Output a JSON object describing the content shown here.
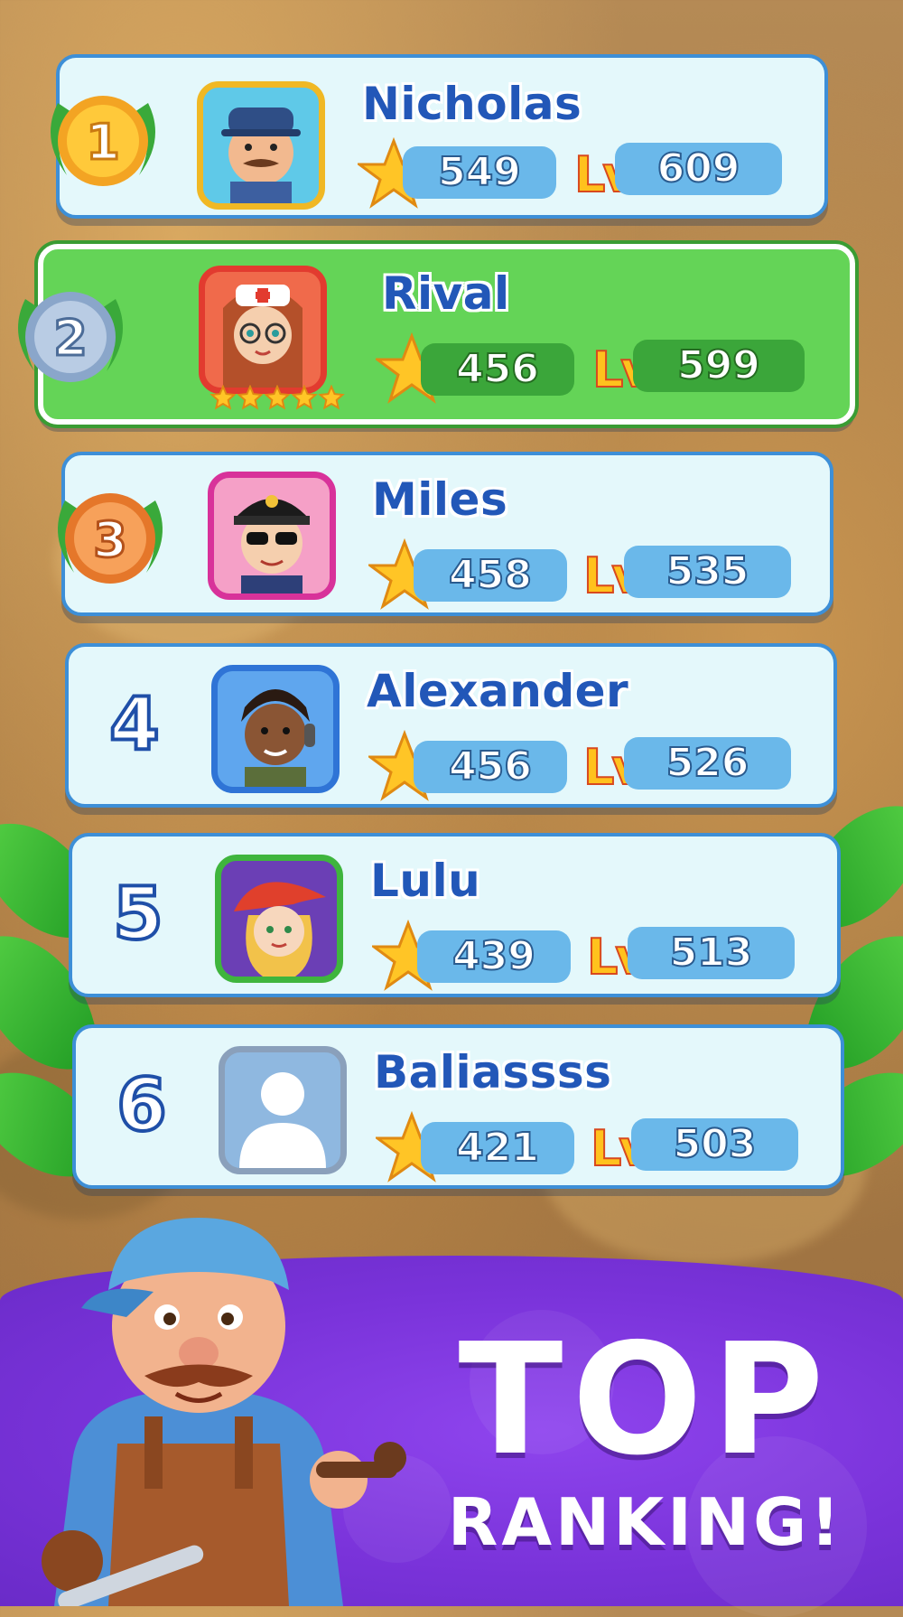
{
  "players": [
    {
      "rank": "1",
      "name": "Nicholas",
      "stars": "549",
      "level": "609",
      "medal": "gold",
      "avatar_frame": "#f0b824",
      "avatar_bg": "#5fc9e8"
    },
    {
      "rank": "2",
      "name": "Rival",
      "stars": "456",
      "level": "599",
      "medal": "silver",
      "avatar_frame": "#e23b2f",
      "avatar_bg": "#f06a4b"
    },
    {
      "rank": "3",
      "name": "Miles",
      "stars": "458",
      "level": "535",
      "medal": "bronze",
      "avatar_frame": "#d8329a",
      "avatar_bg": "#f5a0c7"
    },
    {
      "rank": "4",
      "name": "Alexander",
      "stars": "456",
      "level": "526",
      "medal": "",
      "avatar_frame": "#2f74d6",
      "avatar_bg": "#5fa6ee"
    },
    {
      "rank": "5",
      "name": "Lulu",
      "stars": "439",
      "level": "513",
      "medal": "",
      "avatar_frame": "#3fb53d",
      "avatar_bg": "#6b3fb5"
    },
    {
      "rank": "6",
      "name": "Baliassss",
      "stars": "421",
      "level": "503",
      "medal": "",
      "avatar_frame": "#8aa0bb",
      "avatar_bg": "#8fb8e0"
    }
  ],
  "level_prefix": "Lv",
  "rival_avatar_stars": 5,
  "banner": {
    "line1": "TOP",
    "line2": "RANKING!"
  },
  "colors": {
    "gold": "#f5b529",
    "silver": "#9fb8d8",
    "bronze": "#f0883a",
    "row_bg": "#e4f8fb",
    "rival_bg": "#64d457",
    "banner": "#7a33da"
  }
}
